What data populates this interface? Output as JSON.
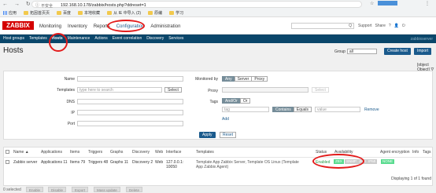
{
  "browser": {
    "insecure": "不安全",
    "url": "192.168.10.178/zabbix/hosts.php?ddreset=1",
    "bookmarks": [
      "应用",
      "拓因首页页",
      "百度",
      "本地收藏",
      "从 IE 中导入 (2)",
      "原编",
      "学习"
    ]
  },
  "logo": "ZABBIX",
  "menu": [
    "Monitoring",
    "Inventory",
    "Reports",
    "Configuration",
    "Administration"
  ],
  "search_label": "Q",
  "header_right": {
    "support": "Support",
    "share": "Share",
    "help": "?"
  },
  "submenu": [
    "Host groups",
    "Templates",
    "Hosts",
    "Maintenance",
    "Actions",
    "Event correlation",
    "Discovery",
    "Services"
  ],
  "server_name": "zabbixserver",
  "page_title": "Hosts",
  "group_label": "Group",
  "group_value": "all",
  "create_host": "Create host",
  "import": "Import",
  "filter": {
    "name": "Name",
    "templates": "Templates",
    "templates_placeholder": "type here to search",
    "select": "Select",
    "dns": "DNS",
    "ip": "IP",
    "port": "Port",
    "monitored_by": "Monitored by",
    "mon_opts": [
      "Any",
      "Server",
      "Proxy"
    ],
    "proxy": "Proxy",
    "tags": "Tags",
    "tag_opts": [
      "And/Or",
      "Or"
    ],
    "tag_placeholder": "tag",
    "tag_ops": [
      "Contains",
      "Equals"
    ],
    "value_placeholder": "value",
    "remove": "Remove",
    "add": "Add",
    "apply": "Apply",
    "reset": "Reset"
  },
  "table": {
    "headers": [
      "Name ▲",
      "Applications",
      "Items",
      "Triggers",
      "Graphs",
      "Discovery",
      "Web",
      "Interface",
      "Templates",
      "Status",
      "Availability",
      "Agent encryption",
      "Info",
      "Tags"
    ],
    "row": {
      "name": "Zabbix server",
      "applications": "Applications 11",
      "items": "Items 79",
      "triggers": "Triggers 48",
      "graphs": "Graphs 11",
      "discovery": "Discovery 2",
      "web": "Web",
      "interface": "127.0.0.1:\n10050",
      "templates": "Template App Zabbix Server, Template OS Linux (Template App Zabbix Agent)",
      "status": "Enabled",
      "zbx": "ZBX",
      "snmp": "SNMP",
      "jmx": "JMX",
      "ipmi": "IPMI",
      "encryption": "NONE"
    }
  },
  "displaying": "Displaying 1 of 1 found",
  "footer": {
    "selected": "0 selected",
    "buttons": [
      "Enable",
      "Disable",
      "Export",
      "Mass update",
      "Delete"
    ]
  },
  "colors": {
    "zabbix_red": "#d40000",
    "nav_blue": "#0a466a",
    "green": "#59db8f",
    "annotation_red": "#e31b1b"
  }
}
